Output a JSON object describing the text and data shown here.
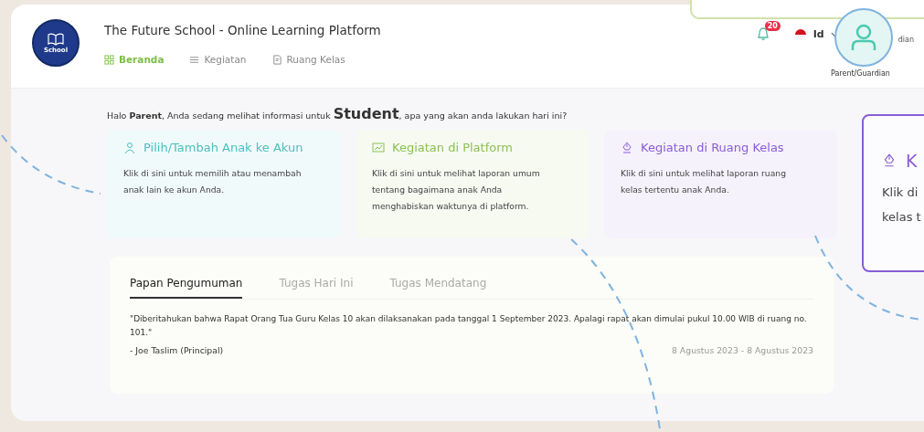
{
  "header": {
    "logo_text": "School",
    "title": "The Future School - Online Learning Platform",
    "nav": [
      {
        "label": "Beranda",
        "selected": true
      },
      {
        "label": "Kegiatan",
        "selected": false
      },
      {
        "label": "Ruang Kelas",
        "selected": false
      }
    ],
    "notification_count": "20",
    "language": "Id",
    "role_partial": "dian"
  },
  "greeting": {
    "before": "Halo **Parent**, Anda sedang melihat informasi untuk ",
    "student": "Student",
    "after": ", apa yang akan anda lakukan hari ini?"
  },
  "cards": [
    {
      "title": "Pilih/Tambah Anak ke Akun",
      "description": "Klik di sini untuk memilih atau menambah anak lain ke akun Anda.",
      "color": "#4cbfbf"
    },
    {
      "title": "Kegiatan di Platform",
      "description": "Klik di sini untuk melihat laporan umum tentang bagaimana anak Anda menghabiskan waktunya di platform.",
      "color": "#8cc152"
    },
    {
      "title": "Kegiatan di Ruang Kelas",
      "description": "Klik di sini untuk melihat laporan ruang kelas tertentu anak Anda.",
      "color": "#8a5cd6"
    }
  ],
  "announcement": {
    "tabs": [
      {
        "label": "Papan Pengumuman",
        "selected": true
      },
      {
        "label": "Tugas Hari Ini",
        "selected": false
      },
      {
        "label": "Tugas Mendatang",
        "selected": false
      }
    ],
    "text": "\"Diberitahukan bahwa Rapat Orang Tua Guru Kelas 10 akan dilaksanakan pada tanggal 1 September 2023. Apalagi rapat akan dimulai pukul 10.00 WIB di ruang no. 101.\"",
    "author": "- Joe Taslim (Principal)",
    "date": "8 Agustus 2023 - 8 Agustus 2023"
  },
  "overlay": {
    "avatar_label": "Parent/Guardian",
    "zoom_card": {
      "title": "K",
      "lines": [
        "Klik di",
        "kelas t"
      ]
    }
  }
}
